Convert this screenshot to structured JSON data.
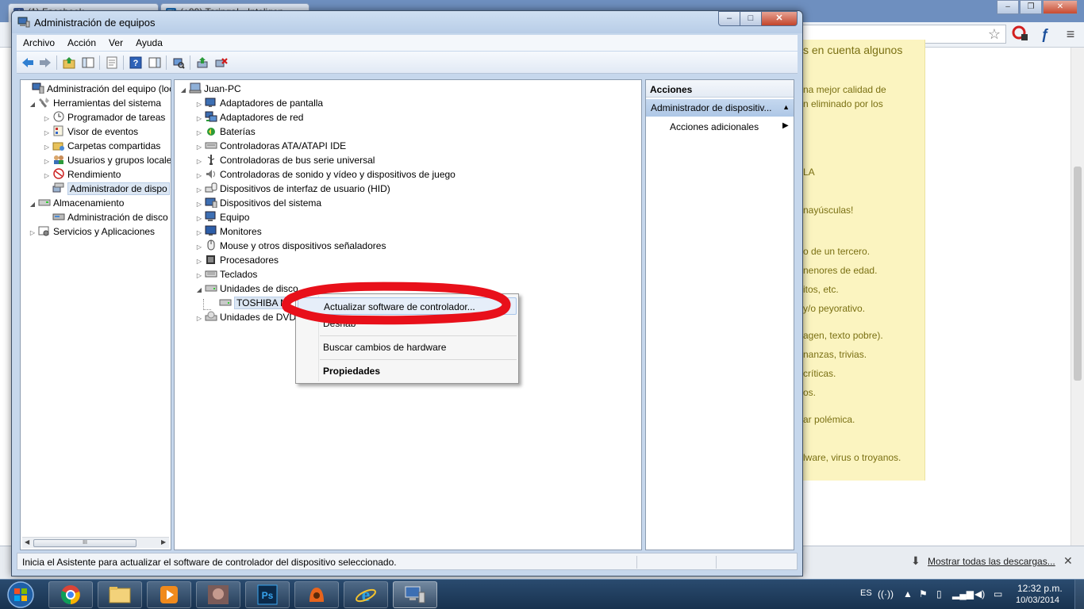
{
  "browser": {
    "tabs": [
      {
        "label": "(1) Facebook",
        "favicon": "f"
      },
      {
        "label": "(+99) Taringa! - Inteligen",
        "favicon": "T!"
      }
    ],
    "downloads_label": "Mostrar todas las descargas...",
    "page_lines": [
      {
        "text": "s en cuenta algunos",
        "big": true
      },
      {
        "text": "na mejor calidad de"
      },
      {
        "text": "n eliminado por los"
      },
      {
        "text": "LA"
      },
      {
        "text": "nayúsculas!"
      },
      {
        "text": "o de un tercero."
      },
      {
        "text": "nenores de edad."
      },
      {
        "text": "itos, etc."
      },
      {
        "text": "y/o peyorativo."
      },
      {
        "text": "agen, texto pobre)."
      },
      {
        "text": "nanzas, trivias."
      },
      {
        "text": "críticas."
      },
      {
        "text": "os."
      },
      {
        "text": "ar polémica."
      },
      {
        "text": "lware, virus o troyanos."
      }
    ]
  },
  "window": {
    "title": "Administración de equipos",
    "controls": {
      "minimize": "–",
      "maximize": "□",
      "close": "✕"
    }
  },
  "menubar": [
    "Archivo",
    "Acción",
    "Ver",
    "Ayuda"
  ],
  "left_tree": [
    {
      "label": "Administración del equipo (loc",
      "level": 0,
      "expander": "",
      "icon": "computer-management-icon"
    },
    {
      "label": "Herramientas del sistema",
      "level": 1,
      "expander": "◢",
      "icon": "system-tools-icon"
    },
    {
      "label": "Programador de tareas",
      "level": 2,
      "expander": "▷",
      "icon": "clock-icon"
    },
    {
      "label": "Visor de eventos",
      "level": 2,
      "expander": "▷",
      "icon": "event-viewer-icon"
    },
    {
      "label": "Carpetas compartidas",
      "level": 2,
      "expander": "▷",
      "icon": "shared-folders-icon"
    },
    {
      "label": "Usuarios y grupos locale",
      "level": 2,
      "expander": "▷",
      "icon": "users-icon"
    },
    {
      "label": "Rendimiento",
      "level": 2,
      "expander": "▷",
      "icon": "performance-icon"
    },
    {
      "label": "Administrador de dispo",
      "level": 2,
      "expander": "",
      "icon": "device-manager-icon",
      "selected": true
    },
    {
      "label": "Almacenamiento",
      "level": 1,
      "expander": "◢",
      "icon": "storage-icon"
    },
    {
      "label": "Administración de disco",
      "level": 2,
      "expander": "",
      "icon": "disk-management-icon"
    },
    {
      "label": "Servicios y Aplicaciones",
      "level": 1,
      "expander": "▷",
      "icon": "services-icon"
    }
  ],
  "device_tree": {
    "root": "Juan-PC",
    "categories": [
      {
        "label": "Adaptadores de pantalla",
        "icon": "display-adapter-icon"
      },
      {
        "label": "Adaptadores de red",
        "icon": "network-adapter-icon"
      },
      {
        "label": "Baterías",
        "icon": "battery-icon"
      },
      {
        "label": "Controladoras ATA/ATAPI IDE",
        "icon": "ide-controller-icon"
      },
      {
        "label": "Controladoras de bus serie universal",
        "icon": "usb-controller-icon"
      },
      {
        "label": "Controladoras de sonido y vídeo y dispositivos de juego",
        "icon": "sound-icon"
      },
      {
        "label": "Dispositivos de interfaz de usuario (HID)",
        "icon": "hid-icon"
      },
      {
        "label": "Dispositivos del sistema",
        "icon": "system-devices-icon"
      },
      {
        "label": "Equipo",
        "icon": "computer-icon"
      },
      {
        "label": "Monitores",
        "icon": "monitor-icon"
      },
      {
        "label": "Mouse y otros dispositivos señaladores",
        "icon": "mouse-icon"
      },
      {
        "label": "Procesadores",
        "icon": "processor-icon"
      },
      {
        "label": "Teclados",
        "icon": "keyboard-icon"
      },
      {
        "label": "Unidades de disco",
        "icon": "disk-drive-icon",
        "expanded": true
      },
      {
        "label": "TOSHIBA M",
        "icon": "disk-drive-icon",
        "child": true
      },
      {
        "label": "Unidades de DVD",
        "icon": "dvd-icon"
      }
    ]
  },
  "context_menu": {
    "items": [
      {
        "label": "Actualizar software de controlador...",
        "highlighted": true
      },
      {
        "label": "Deshab"
      },
      {
        "label": "Buscar cambios de hardware"
      },
      {
        "label": "Propiedades",
        "bold": true
      }
    ]
  },
  "actions_pane": {
    "header": "Acciones",
    "section": "Administrador de dispositiv...",
    "more": "Acciones adicionales"
  },
  "statusbar": {
    "text": "Inicia el Asistente para actualizar el software de controlador del dispositivo seleccionado."
  },
  "taskbar": {
    "language": "ES",
    "time": "12:32 p.m.",
    "date": "10/03/2014",
    "apps": [
      "chrome-icon",
      "explorer-icon",
      "media-player-icon",
      "photo-icon",
      "photoshop-icon",
      "app-icon",
      "internet-explorer-icon",
      "computer-management-icon"
    ]
  },
  "colors": {
    "annotation": "#e8101a",
    "window_frame": "#c6d7ec",
    "selection": "#dbe6f3"
  }
}
